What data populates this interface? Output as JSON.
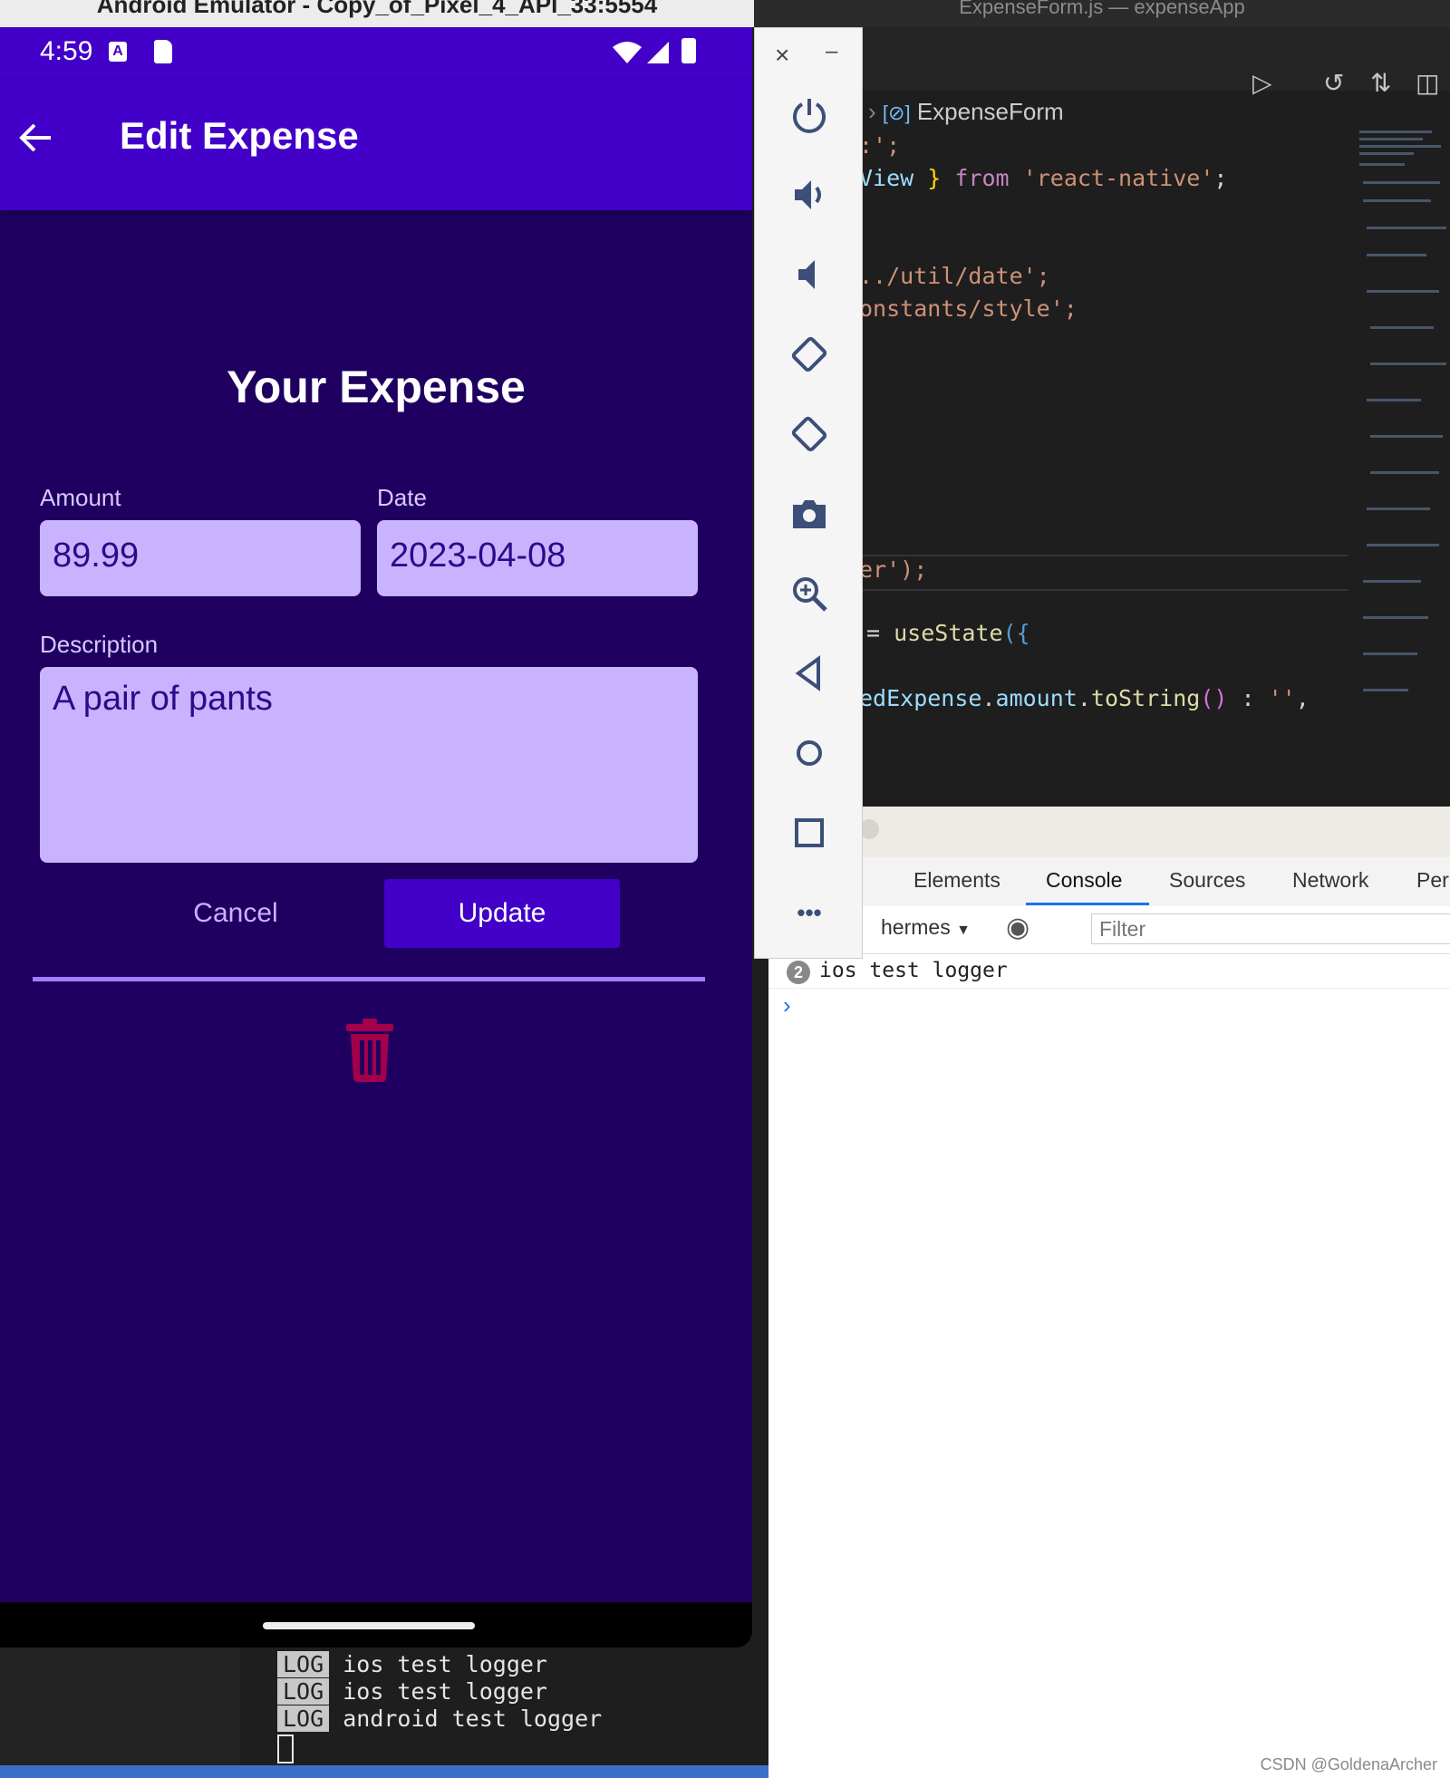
{
  "emulator": {
    "window_title": "Android Emulator - Copy_of_Pixel_4_API_33:5554",
    "status_time": "4:59",
    "appbar_title": "Edit Expense",
    "screen_title": "Your Expense",
    "amount": {
      "label": "Amount",
      "value": "89.99"
    },
    "date": {
      "label": "Date",
      "value": "2023-04-08"
    },
    "description": {
      "label": "Description",
      "value": "A pair of pants"
    },
    "cancel_label": "Cancel",
    "update_label": "Update",
    "colors": {
      "primary": "#4200c9",
      "background": "#1f0060",
      "input": "#c9b3ff",
      "delete": "#a3004c"
    }
  },
  "emulator_panel": {
    "close": "×",
    "minimize": "–",
    "more": "•••"
  },
  "vscode": {
    "window_title": "ExpenseForm.js — expenseApp",
    "breadcrumb": "ExpenseForm",
    "code_lines": [
      ":';",
      "View } from 'react-native';",
      "../util/date';",
      "onstants/style';",
      "er');",
      "= useState({",
      "edExpense.amount.toString() : '',"
    ]
  },
  "devtools": {
    "tabs": [
      "Elements",
      "Console",
      "Sources",
      "Network",
      "Per"
    ],
    "active_tab": "Console",
    "context": "hermes",
    "filter_placeholder": "Filter",
    "log_count": "2",
    "log_message": "ios test logger",
    "prompt": "›"
  },
  "terminal": {
    "lines": [
      {
        "tag": "LOG",
        "text": "ios test logger"
      },
      {
        "tag": "LOG",
        "text": "ios test logger"
      },
      {
        "tag": "LOG",
        "text": "android test logger"
      }
    ]
  },
  "watermark": "CSDN @GoldenaArcher"
}
